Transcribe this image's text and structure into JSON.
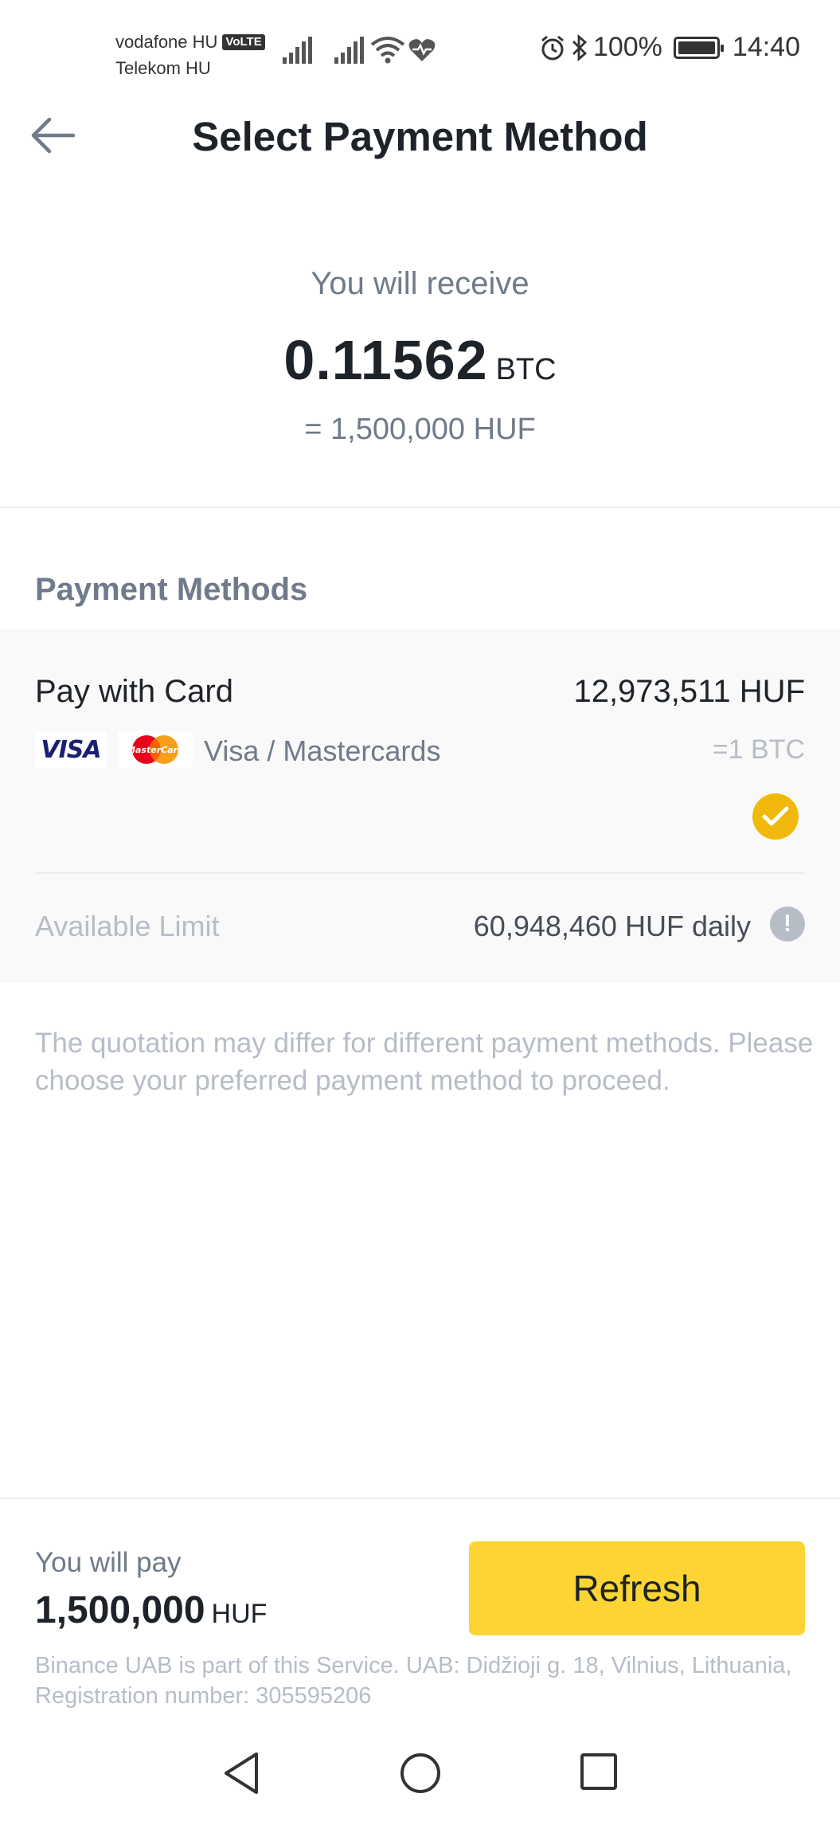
{
  "status_bar": {
    "carrier_1": "vodafone HU",
    "volte_badge": "VoLTE",
    "carrier_2": "Telekom HU",
    "battery": "100%",
    "time": "14:40",
    "battery_level_percent": 100,
    "icons": [
      "signal-icon",
      "signal-icon",
      "wifi-icon",
      "heart-rate-icon",
      "alarm-icon",
      "bluetooth-icon",
      "battery-icon"
    ]
  },
  "header": {
    "title": "Select Payment Method",
    "back_icon": "arrow-left-icon"
  },
  "receive": {
    "label": "You will receive",
    "amount": "0.11562",
    "unit": "BTC",
    "equivalent": "= 1,500,000 HUF"
  },
  "payment_methods": {
    "heading": "Payment Methods",
    "items": [
      {
        "name": "Pay with Card",
        "price": "12,973,511 HUF",
        "logos": [
          "VISA",
          "MasterCard"
        ],
        "subtitle": "Visa / Mastercards",
        "rate": "=1 BTC",
        "selected": true,
        "limit_label": "Available Limit",
        "limit_value": "60,948,460 HUF daily"
      }
    ]
  },
  "note": "The quotation may differ for different payment methods. Please choose your preferred payment method to proceed.",
  "footer": {
    "pay_label": "You will pay",
    "pay_amount": "1,500,000",
    "pay_unit": "HUF",
    "refresh_label": "Refresh",
    "legal": "Binance UAB is part of this Service. UAB: Didžioji g. 18, Vilnius, Lithuania, Registration number: 305595206"
  },
  "colors": {
    "accent": "#FCD535",
    "check": "#F0B90B",
    "text_primary": "#1E2329",
    "text_secondary": "#707A8A",
    "text_muted": "#B7BDC6",
    "card_bg": "#F9F9F9"
  }
}
